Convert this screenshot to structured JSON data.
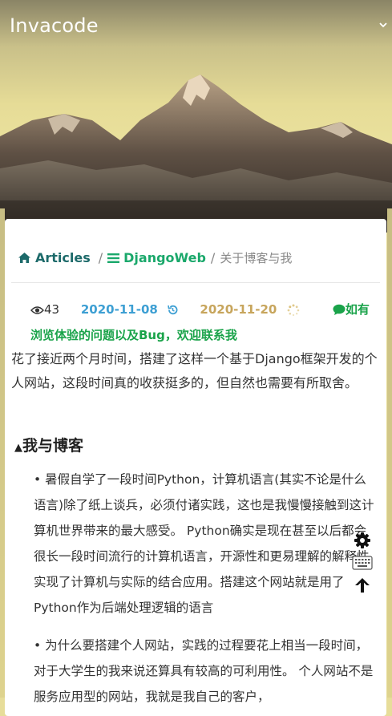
{
  "header": {
    "brand": "Invacode",
    "toggle_icon": "chevron-down-icon"
  },
  "breadcrumb": {
    "items": [
      {
        "label": "Articles",
        "icon": "home-icon"
      },
      {
        "label": "DjangoWeb",
        "icon": "list-icon"
      }
    ],
    "separator": "/",
    "current": "关于博客与我"
  },
  "meta": {
    "views": "43",
    "created": "2020-11-08",
    "updated": "2020-11-20",
    "notice": "如有浏览体验的问题以及Bug，欢迎联系我"
  },
  "article": {
    "intro": "花了接近两个月时间，搭建了这样一个基于Django框架开发的个人网站，这段时间真的收获挺多的，但自然也需要有所取舍。",
    "section_title": "我与博客",
    "section_marker": "▲",
    "bullets": [
      "• 暑假自学了一段时间Python，计算机语言(其实不论是什么语言)除了纸上谈兵，必须付诸实践，这也是我慢慢接触到这计算机世界带来的最大感受。 Python确实是现在甚至以后都会很长一段时间流行的计算机语言，开源性和更易理解的解释性实现了计算机与实际的结合应用。搭建这个网站就是用了Python作为后端处理逻辑的语言",
      "• 为什么要搭建个人网站，实践的过程要花上相当一段时间，对于大学生的我来说还算具有较高的可利用性。 个人网站不是服务应用型的网站，我就是我自己的客户，"
    ]
  },
  "tools": [
    "gear-icon",
    "keyboard-icon",
    "arrow-up-icon"
  ],
  "colors": {
    "breadcrumb_home": "#1d6a6a",
    "breadcrumb_category": "#1aa86b",
    "date_created": "#3d9fd3",
    "date_updated": "#c7a55c",
    "notice": "#1aa34a"
  }
}
